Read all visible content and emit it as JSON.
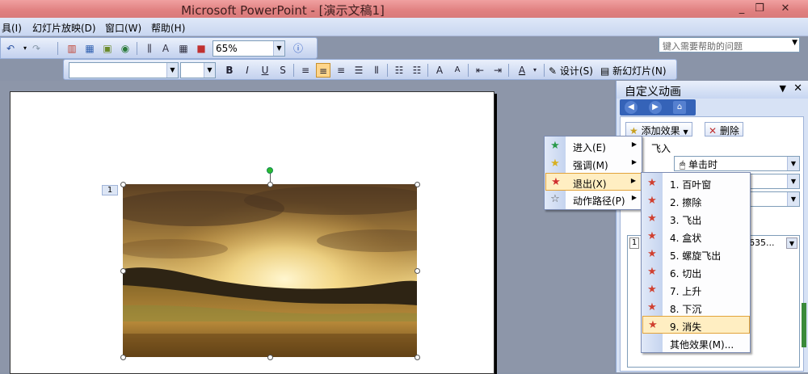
{
  "window": {
    "title": "Microsoft PowerPoint - [演示文稿1]",
    "controls": [
      "_",
      "❐",
      "✕"
    ]
  },
  "menubar": {
    "items": [
      "具(I)",
      "幻灯片放映(D)",
      "窗口(W)",
      "帮助(H)"
    ]
  },
  "help": {
    "placeholder": "键入需要帮助的问题"
  },
  "toolbar": {
    "zoom": "65%"
  },
  "format_bar": {
    "design_label": "设计(S)",
    "new_slide_label": "新幻灯片(N)"
  },
  "slide": {
    "animation_tag": "1"
  },
  "pane": {
    "title": "自定义动画",
    "add_effect": "添加效果",
    "remove": "删除",
    "effect_name": "飞入",
    "start_value": "单击时",
    "list_item_index": "1",
    "list_item_text": "635..."
  },
  "menu_effects": {
    "items": [
      {
        "label": "进入(E)",
        "icon": "green-star"
      },
      {
        "label": "强调(M)",
        "icon": "yellow-star"
      },
      {
        "label": "退出(X)",
        "icon": "red-star"
      },
      {
        "label": "动作路径(P)",
        "icon": "path-star"
      }
    ]
  },
  "menu_exit": {
    "items": [
      "1. 百叶窗",
      "2. 擦除",
      "3. 飞出",
      "4. 盒状",
      "5. 螺旋飞出",
      "6. 切出",
      "7. 上升",
      "8. 下沉",
      "9. 消失"
    ],
    "more": "其他效果(M)..."
  },
  "colors": {
    "title_bar": "#e08080",
    "highlight": "#ffeec2",
    "pane_nav": "#3563b8"
  }
}
